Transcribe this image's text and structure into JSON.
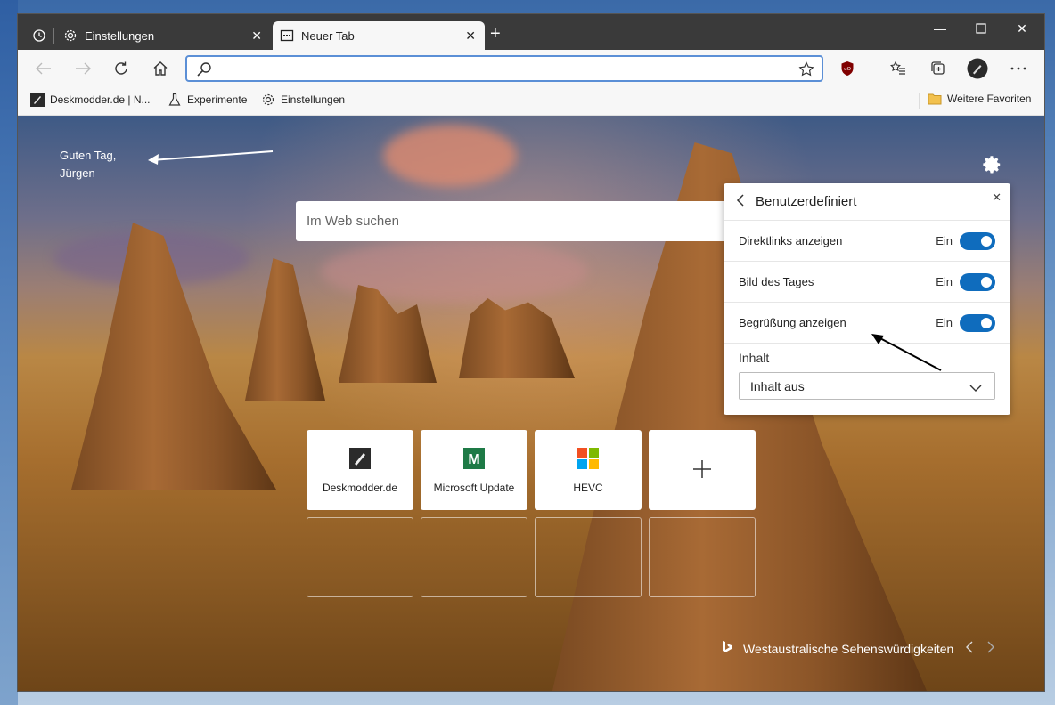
{
  "tabs": [
    {
      "label": "Einstellungen",
      "active": false
    },
    {
      "label": "Neuer Tab",
      "active": true
    }
  ],
  "omnibox": {
    "value": ""
  },
  "favorites": {
    "items": [
      "Deskmodder.de | N...",
      "Experimente",
      "Einstellungen"
    ],
    "more": "Weitere Favoriten"
  },
  "greeting": {
    "line1": "Guten Tag,",
    "line2": "Jürgen"
  },
  "search": {
    "placeholder": "Im Web suchen"
  },
  "panel": {
    "title": "Benutzerdefiniert",
    "rows": [
      {
        "label": "Direktlinks anzeigen",
        "state": "Ein",
        "on": true
      },
      {
        "label": "Bild des Tages",
        "state": "Ein",
        "on": true
      },
      {
        "label": "Begrüßung anzeigen",
        "state": "Ein",
        "on": true
      }
    ],
    "inhalt_label": "Inhalt",
    "inhalt_value": "Inhalt aus"
  },
  "tiles": [
    {
      "label": "Deskmodder.de",
      "icon": "deskmodder-icon"
    },
    {
      "label": "Microsoft Update",
      "icon": "m-icon"
    },
    {
      "label": "HEVC",
      "icon": "microsoft-logo-icon"
    },
    {
      "label": "",
      "icon": "plus-icon"
    }
  ],
  "image_caption": "Westaustralische Sehenswürdigkeiten",
  "colors": {
    "accent": "#0f6cbd",
    "tabbar": "#3a3a3a"
  }
}
